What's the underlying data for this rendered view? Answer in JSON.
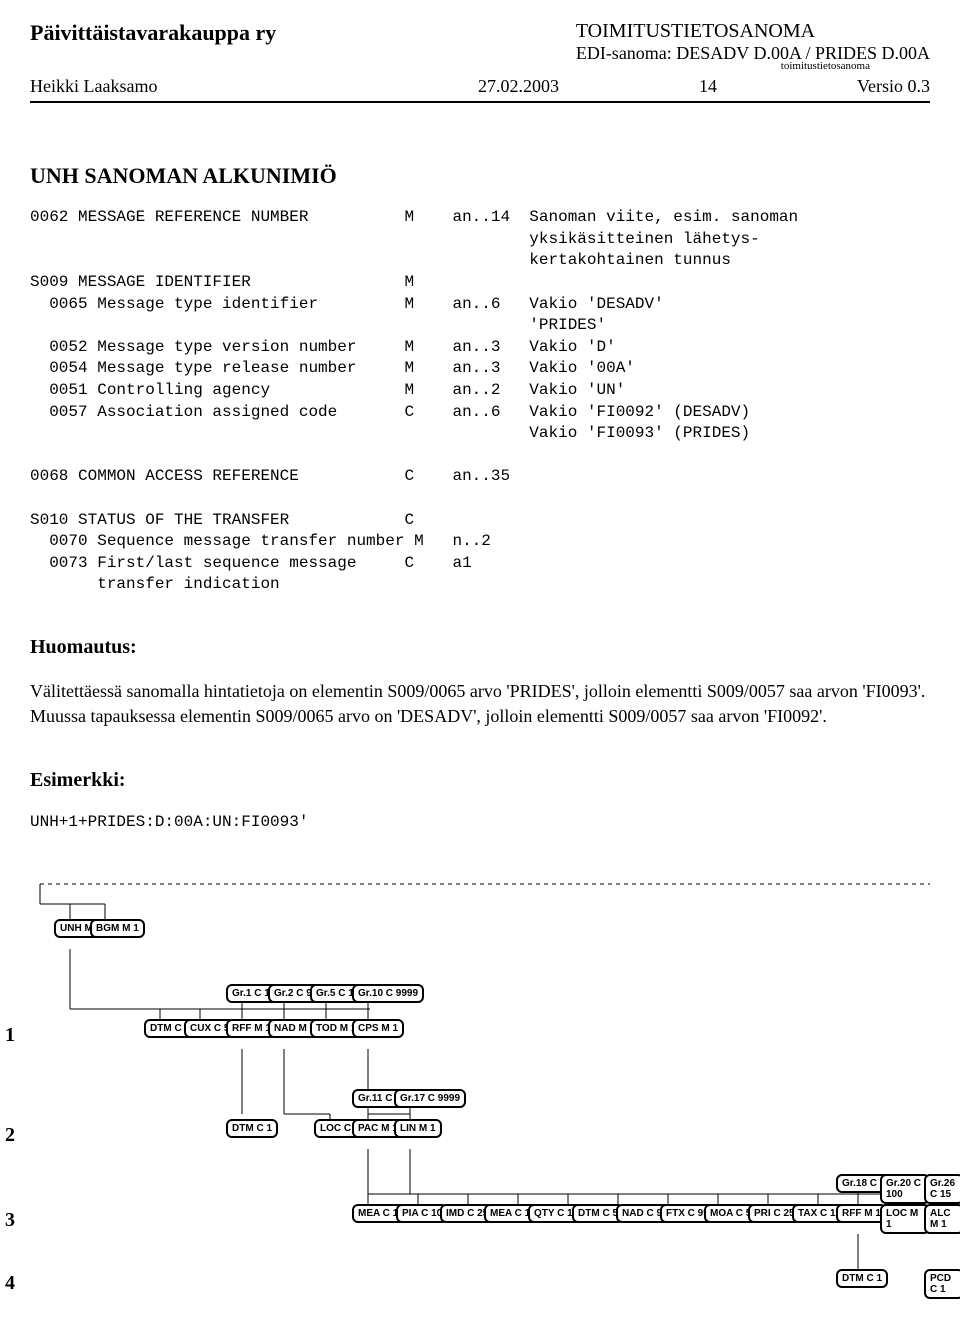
{
  "header": {
    "org": "Päivittäistavarakauppa ry",
    "doc_title": "TOIMITUSTIETOSANOMA",
    "edi_line": "EDI-sanoma: DESADV D.00A / PRIDES D.00A",
    "tiny": "toimitustietosanoma",
    "author": "Heikki Laaksamo",
    "date": "27.02.2003",
    "page": "14",
    "version": "Versio 0.3"
  },
  "section_title": "UNH    SANOMAN ALKUNIMIÖ",
  "segment_block": "0062 MESSAGE REFERENCE NUMBER          M    an..14  Sanoman viite, esim. sanoman\n                                                    yksikäsitteinen lähetys-\n                                                    kertakohtainen tunnus\nS009 MESSAGE IDENTIFIER                M\n  0065 Message type identifier         M    an..6   Vakio 'DESADV'\n                                                    'PRIDES'\n  0052 Message type version number     M    an..3   Vakio 'D'\n  0054 Message type release number     M    an..3   Vakio '00A'\n  0051 Controlling agency              M    an..2   Vakio 'UN'\n  0057 Association assigned code       C    an..6   Vakio 'FI0092' (DESADV)\n                                                    Vakio 'FI0093' (PRIDES)\n\n0068 COMMON ACCESS REFERENCE           C    an..35\n\nS010 STATUS OF THE TRANSFER            C\n  0070 Sequence message transfer number M   n..2\n  0073 First/last sequence message     C    a1\n       transfer indication",
  "huomautus_title": "Huomautus:",
  "huomautus_body": "Välitettäessä sanomalla hintatietoja on elementin S009/0065 arvo 'PRIDES', jolloin elementti S009/0057 saa arvon 'FI0093'. Muussa tapauksessa elementin S009/0065 arvo on 'DESADV', jolloin elementti S009/0057 saa arvon 'FI0092'.",
  "esimerkki_title": "Esimerkki:",
  "esimerkki_code": "UNH+1+PRIDES:D:00A:UN:FI0093'",
  "row_labels": {
    "r1": "1",
    "r2": "2",
    "r3": "3",
    "r4": "4"
  },
  "nodes": {
    "unh": "UNH\nM  1",
    "bgm": "BGM\nM  1",
    "dtm10": "DTM\nC  10",
    "cux5": "CUX\nC  5",
    "gr1": "Gr.1\nC 10",
    "rff1": "RFF\nM  1",
    "gr2": "Gr.2\nC 99",
    "nad1": "NAD\nM  1",
    "gr5": "Gr.5\nC  10",
    "tod1": "TOD\nM  1",
    "gr10": "Gr.10\nC  9999",
    "cps1": "CPS\nM 1",
    "dtm1": "DTM\nC  1",
    "loc5": "LOC\nC  5",
    "gr11": "Gr.11\nC  9999",
    "pac1": "PAC\nM  1",
    "gr17": "Gr.17\nC  9999",
    "lin1": "LIN\nM  1",
    "mea10a": "MEA\nC  10",
    "pia10": "PIA\nC  10",
    "imd25": "IMD\nC  25",
    "mea10b": "MEA\nC  10",
    "qty10": "QTY\nC  10",
    "dtm5": "DTM\nC  5",
    "nad99": "NAD\nC 99",
    "ftx99": "FTX\nC  99",
    "moa5": "MOA\nC  5",
    "pri25": "PRI\nC  25",
    "tax10": "TAX\nC  10",
    "gr18": "Gr.18\nC  99",
    "rff18": "RFF\nM  1",
    "gr20": "Gr.20\nC  100",
    "loc20": "LOC\nM  1",
    "gr26": "Gr.26\nC 15",
    "alc1": "ALC\nM  1",
    "dtm_c1": "DTM\nC  1",
    "pcd_c1": "PCD\nC  1"
  }
}
